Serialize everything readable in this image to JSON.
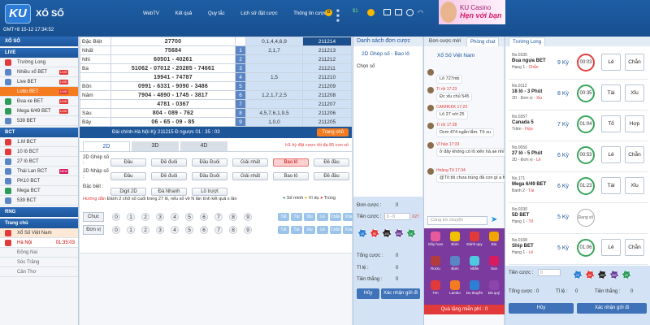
{
  "header": {
    "logo": "KU",
    "brand": "XỔ SỐ",
    "clock": "GMT+8 15-12 17:34:52",
    "nav": [
      "WebTV",
      "Kết quả",
      "Quy tắc",
      "Lịch sử đặt cược",
      "Thông tin cược ▾"
    ],
    "balance_coin": "B",
    "account_mask": "■ ■ ■",
    "balance_value": "$1",
    "banner_line1": "KU Casino",
    "banner_line2": "Hẹn với bạn"
  },
  "sidebar": {
    "title": "XỔ SỐ",
    "live_header": "LIVE",
    "live_items": [
      {
        "label": "Trường Long",
        "color": "#e23a3a",
        "live": false
      },
      {
        "label": "Nhiều xổ BET",
        "color": "#5a86c6",
        "live": true
      },
      {
        "label": "Live BET",
        "color": "#5a86c6",
        "live": true
      },
      {
        "label": "Lotto BET",
        "color": "#f47b1f",
        "live": true
      },
      {
        "label": "Đua xe BET",
        "color": "#2d9c5a",
        "live": true
      },
      {
        "label": "Mega 6/49 BET",
        "color": "#2d9c5a",
        "live": true
      },
      {
        "label": "539 BET",
        "color": "#5a86c6",
        "live": false
      }
    ],
    "bct_header": "BCT",
    "bct_items": [
      {
        "label": "1.M BCT",
        "color": "#e23a3a"
      },
      {
        "label": "10 lô BCT",
        "color": "#e23a3a"
      },
      {
        "label": "27 lô BCT",
        "color": "#5a86c6"
      },
      {
        "label": "Thái Lan BCT",
        "color": "#5a86c6",
        "new": "NEW"
      },
      {
        "label": "PK10 BCT",
        "color": "#5a86c6"
      },
      {
        "label": "Mega BCT",
        "color": "#2d9c5a"
      },
      {
        "label": "539 BCT",
        "color": "#5a86c6"
      }
    ],
    "rng_header": "RNG",
    "home_header": "Trang chủ",
    "vn_item": "Xổ Số Việt Nam",
    "regions": [
      {
        "label": "Hà Nội",
        "time": "01:35:03",
        "active": true
      },
      {
        "label": "Đồng Nai"
      },
      {
        "label": "Sóc Trăng"
      },
      {
        "label": "Cần Thơ"
      }
    ]
  },
  "results": {
    "rows": [
      {
        "label": "Đặc Biệt",
        "nums": "27700",
        "idx": "",
        "digits": "0,1,4,4,6,9",
        "session": "211214",
        "hdr": true
      },
      {
        "label": "Nhất",
        "nums": "75684",
        "idx": "1",
        "digits": "2,1,7",
        "session": "211213"
      },
      {
        "label": "Nhì",
        "nums": "60501 - 40261",
        "idx": "2",
        "digits": "",
        "session": "211212"
      },
      {
        "label": "Ba",
        "nums": "51062 - 07012 - 20285 - 74661",
        "idx": "3",
        "digits": "",
        "session": "211211"
      },
      {
        "label": "",
        "nums": "19941 - 74787",
        "idx": "4",
        "digits": "1,5",
        "session": "211210"
      },
      {
        "label": "Bốn",
        "nums": "0991 - 6331 - 9090 - 3486",
        "idx": "5",
        "digits": "",
        "session": "211209"
      },
      {
        "label": "Năm",
        "nums": "7904 - 4890 - 1745 - 3817",
        "idx": "6",
        "digits": "1,2,1,7,2,5",
        "session": "211208"
      },
      {
        "label": "",
        "nums": "4781 - 0367",
        "idx": "7",
        "digits": "",
        "session": "211207"
      },
      {
        "label": "Sáu",
        "nums": "804 - 089 - 762",
        "idx": "8",
        "digits": "4,5,7,6,1,9,5",
        "session": "211206"
      },
      {
        "label": "Bảy",
        "nums": "06 - 65 - 09 - 85",
        "idx": "9",
        "digits": "1,0,0",
        "session": "211205"
      }
    ],
    "drawbar": "Đài chính-Hà Nội  Kỳ 211215          Đ ngược  01 : 35 : 03",
    "change_btn": "Trang chủ"
  },
  "tabs": [
    "2D",
    "3D",
    "4D"
  ],
  "tab_hint": "H1 kỳ đặt cược tối đa 85 con số",
  "bet_rows": [
    {
      "label": "2D Ghép số :",
      "buttons": [
        "Đầu",
        "Đề đuôi",
        "Đầu Đuôi",
        "Giải nhất",
        "Bao lô",
        "Đề đầu"
      ]
    },
    {
      "label": "2D Nhập số :",
      "buttons": [
        "Đầu",
        "Đề đuôi",
        "Đầu Đuôi",
        "Giải nhất",
        "Bao lô",
        "Đề đầu"
      ]
    },
    {
      "label": "Đặc biệt :",
      "buttons": [
        "Digit 2D",
        "Đá Nhanh",
        "Lô trượt"
      ]
    }
  ],
  "guide_label": "Hướng dẫn",
  "guide_text": "Đánh 2 chữ số cuối trong 27 lô, nếu số về N lần tính kết quả x lần",
  "guide_opts": [
    "Số mình",
    "Ví dụ",
    "Trúng"
  ],
  "digit_rows": [
    {
      "label": "Chục"
    },
    {
      "label": "Đơn vị"
    }
  ],
  "digits": [
    "0",
    "1",
    "2",
    "3",
    "4",
    "5",
    "6",
    "7",
    "8",
    "9"
  ],
  "quick": [
    "Tất",
    "Tài",
    "Xỉu",
    "Lẻ",
    "Chẵn",
    "Xóa"
  ],
  "order": {
    "header": "Danh sách đơn cược",
    "type": "2D Ghép số - Bao lô",
    "picked": "Chọn số",
    "stake_label": "Đơn cược :",
    "stake_val": "0",
    "amount_label": "Tiền cược :",
    "amount_ph": "0 - 0",
    "amount_max": "X27",
    "total_label": "Tổng cược :",
    "total_val": "0",
    "ratio_label": "Tỉ lệ :",
    "ratio_val": "0",
    "win_label": "Tiền thắng :",
    "win_val": "0",
    "cancel": "Hủy",
    "confirm": "Xác nhận gửi đi",
    "chips": [
      {
        "v": "10",
        "c": "#2d7fd6"
      },
      {
        "v": "50",
        "c": "#e23a3a"
      },
      {
        "v": "100",
        "c": "#222"
      },
      {
        "v": "500",
        "c": "#6a3d9a"
      },
      {
        "v": "1K",
        "c": "#2d9c5a"
      }
    ]
  },
  "chat": {
    "tabs": [
      "Đơn cược mới",
      "Phòng chat"
    ],
    "title": "Xổ Số Việt Nam",
    "messages": [
      {
        "name": "",
        "text": "Lô 727mb"
      },
      {
        "name": "Tí rồi 17:23",
        "text": "Đc xỉu chủ 545"
      },
      {
        "name": "CANHKKK 17:23",
        "text": "Lô 27 với 25"
      },
      {
        "name": "Tí rồi 17:28",
        "text": "Dcm 474 ngắn lắm. Tô su"
      },
      {
        "name": "Vĩ hào 17:33",
        "text": "ở đây không có lô xiên hả ae nhỉ"
      },
      {
        "name": "Hoàng Tổ 17:34",
        "text": "@Tít tôi chưa trúng đâ con gì a fita"
      }
    ],
    "input_ph": "Cùng trò chuyện",
    "gifts": [
      {
        "n": "Gây hoa!",
        "c": "#e85a9c"
      },
      {
        "n": "Bùm",
        "c": "#f2c200"
      },
      {
        "n": "Đánh quy",
        "c": "#e23a3a"
      },
      {
        "n": "Bia",
        "c": "#f2a400"
      },
      {
        "n": "Rượu",
        "c": "#b23c3c"
      },
      {
        "n": "Bùm",
        "c": "#5a86c6"
      },
      {
        "n": "Nhẫn",
        "c": "#4ec9e0"
      },
      {
        "n": "Son",
        "c": "#d81b60"
      },
      {
        "n": "Tim",
        "c": "#e23a3a"
      },
      {
        "n": "Lambo",
        "c": "#f47b1f"
      },
      {
        "n": "Du thuyền",
        "c": "#2d7fd6"
      },
      {
        "n": "Đá quý",
        "c": "#8e44ad"
      }
    ],
    "free": "Quà tặng miễn phí : 0"
  },
  "longdragon": {
    "tab": "Trường Long",
    "cards": [
      {
        "no": "No.0335",
        "game": "Đua ngựa BET",
        "res": "Hạng 1 - ",
        "hi": "Chẵn",
        "ky": "9 Kỳ",
        "time": "00:03",
        "red": true,
        "b1": "Lẻ",
        "b2": "Chẵn"
      },
      {
        "no": "No.0112",
        "game": "18 lô - 3 Phút",
        "res": "2D - Đơn vị - ",
        "hi": "Xỉu",
        "ky": "8 Kỳ",
        "time": "00:35",
        "b1": "Tài",
        "b2": "Xỉu"
      },
      {
        "no": "No.0357",
        "game": "Canada 5",
        "res": "Trăm - ",
        "hi": "Hợp",
        "ky": "7 Kỳ",
        "time": "01:04",
        "b1": "Tổ",
        "b2": "Hợp"
      },
      {
        "no": "No.0056",
        "game": "27 lô - 5 Phút",
        "res": "2D - Đơn vị - ",
        "hi": "Lẻ",
        "ky": "6 Kỳ",
        "time": "00:53",
        "b1": "Lẻ",
        "b2": "Chẵn"
      },
      {
        "no": "No.171",
        "game": "Mega 6/49 BET",
        "res": "Banh 2 - ",
        "hi": "Tài",
        "ky": "6 Kỳ",
        "time": "01:23",
        "b1": "Tài",
        "b2": "Xỉu"
      },
      {
        "no": "No.0330",
        "game": "5D BET",
        "res": "Hạng 1 - ",
        "hi": "Tổ",
        "ky": "5 Kỳ",
        "pending": "Đang xổ"
      },
      {
        "no": "No.0168",
        "game": "Ship BET",
        "res": "Hạng 1 - ",
        "hi": "Lẻ",
        "ky": "5 Kỳ",
        "time": "01:06",
        "b1": "Lẻ",
        "b2": "Chẵn"
      }
    ],
    "amount_label": "Tiền cược :",
    "amount_val": "0",
    "total_label": "Tổng cược :",
    "total_val": "0",
    "ratio_label": "Tỉ lệ :",
    "ratio_val": "0",
    "win_label": "Tiền thắng :",
    "win_val": "0",
    "cancel": "Hủy",
    "confirm": "Xác nhận gửi đi"
  }
}
